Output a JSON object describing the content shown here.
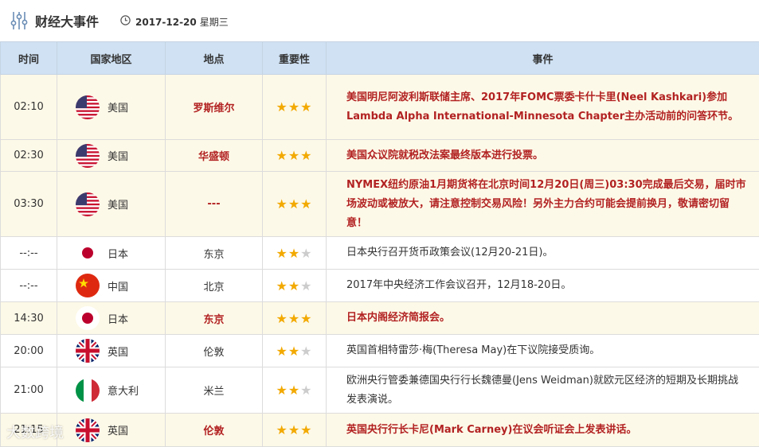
{
  "header": {
    "title": "财经大事件",
    "date": "2017-12-20",
    "weekday": "星期三"
  },
  "columns": [
    "时间",
    "国家地区",
    "地点",
    "重要性",
    "事件"
  ],
  "rows": [
    {
      "time": "02:10",
      "country": "美国",
      "flag": "us-flag",
      "place": "罗斯维尔",
      "stars": 3,
      "highlight": true,
      "event": "美国明尼阿波利斯联储主席、2017年FOMC票委卡什卡里(Neel Kashkari)参加Lambda Alpha International-Minnesota Chapter主办活动前的问答环节。"
    },
    {
      "time": "02:30",
      "country": "美国",
      "flag": "us-flag",
      "place": "华盛顿",
      "stars": 3,
      "highlight": true,
      "event": "美国众议院就税改法案最终版本进行投票。"
    },
    {
      "time": "03:30",
      "country": "美国",
      "flag": "us-flag",
      "place": "---",
      "stars": 3,
      "highlight": true,
      "event": "NYMEX纽约原油1月期货将在北京时间12月20日(周三)03:30完成最后交易，届时市场波动或被放大，请注意控制交易风险！另外主力合约可能会提前换月，敬请密切留意！"
    },
    {
      "time": "--:--",
      "country": "日本",
      "flag": "japan-flag",
      "place": "东京",
      "stars": 2,
      "highlight": false,
      "event": "日本央行召开货币政策会议(12月20-21日)。"
    },
    {
      "time": "--:--",
      "country": "中国",
      "flag": "china-flag",
      "place": "北京",
      "stars": 2,
      "highlight": false,
      "event": "2017年中央经济工作会议召开，12月18-20日。"
    },
    {
      "time": "14:30",
      "country": "日本",
      "flag": "japan-flag",
      "place": "东京",
      "stars": 3,
      "highlight": true,
      "event": "日本内阁经济简报会。"
    },
    {
      "time": "20:00",
      "country": "英国",
      "flag": "uk-flag",
      "place": "伦敦",
      "stars": 2,
      "highlight": false,
      "event": "英国首相特雷莎·梅(Theresa May)在下议院接受质询。"
    },
    {
      "time": "21:00",
      "country": "意大利",
      "flag": "italy-flag",
      "place": "米兰",
      "stars": 2,
      "highlight": false,
      "event": "欧洲央行管委兼德国央行行长魏德曼(Jens Weidman)就欧元区经济的短期及长期挑战发表演说。"
    },
    {
      "time": "21:15",
      "country": "英国",
      "flag": "uk-flag",
      "place": "伦敦",
      "stars": 3,
      "highlight": true,
      "event": "英国央行行长卡尼(Mark Carney)在议会听证会上发表讲话。"
    }
  ],
  "watermark": "大数跨境",
  "colors": {
    "highlight_text": "#b22222",
    "star_on": "#f2a900",
    "star_off": "#cccccc",
    "header_bg": "#cfe1f3"
  }
}
